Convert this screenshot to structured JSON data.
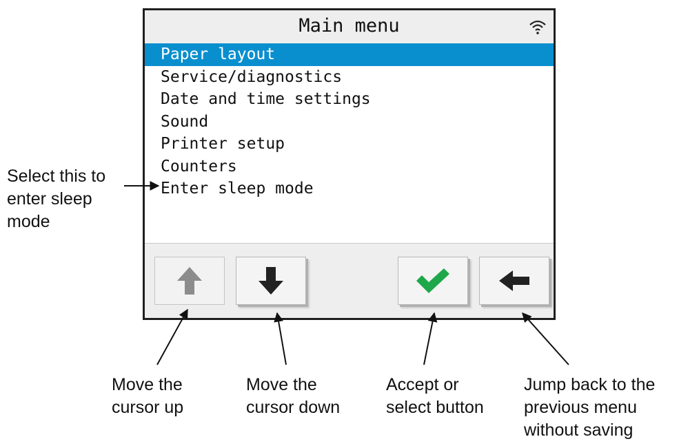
{
  "screen": {
    "title": "Main menu",
    "status_icon": "wifi-icon",
    "menu_items": [
      {
        "label": "Paper layout",
        "selected": true
      },
      {
        "label": "Service/diagnostics",
        "selected": false
      },
      {
        "label": "Date and time settings",
        "selected": false
      },
      {
        "label": "Sound",
        "selected": false
      },
      {
        "label": "Printer setup",
        "selected": false
      },
      {
        "label": "Counters",
        "selected": false
      },
      {
        "label": "Enter sleep mode",
        "selected": false
      }
    ],
    "buttons": [
      {
        "name": "up-button",
        "icon": "arrow-up-icon"
      },
      {
        "name": "down-button",
        "icon": "arrow-down-icon"
      },
      {
        "name": "accept-button",
        "icon": "checkmark-icon"
      },
      {
        "name": "back-button",
        "icon": "arrow-left-icon"
      }
    ],
    "colors": {
      "selection": "#0a8fce",
      "checkmark": "#1ea84a"
    }
  },
  "annotations": {
    "sleep": [
      "Select this to",
      "enter sleep",
      "mode"
    ],
    "up": [
      "Move the",
      "cursor up"
    ],
    "down": [
      "Move the",
      "cursor down"
    ],
    "accept": [
      "Accept or",
      "select button"
    ],
    "back": [
      "Jump back to the",
      "previous menu",
      "without saving"
    ]
  }
}
